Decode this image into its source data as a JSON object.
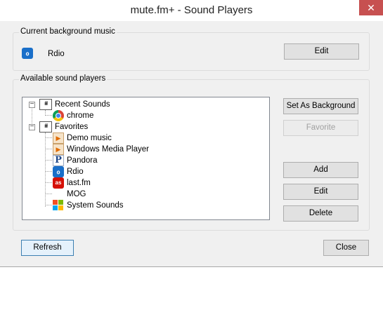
{
  "window": {
    "title": "mute.fm+ - Sound Players",
    "close_glyph": "✕"
  },
  "current_group": {
    "legend": "Current background music",
    "player_name": "Rdio",
    "player_icon": "rdio-icon",
    "edit_label": "Edit"
  },
  "available_group": {
    "legend": "Available sound players",
    "tree": {
      "recent": {
        "label": "Recent Sounds",
        "icon": "equalizer-icon",
        "expanded": true,
        "children": [
          {
            "label": "chrome",
            "icon": "chrome-icon"
          }
        ]
      },
      "favorites": {
        "label": "Favorites",
        "icon": "equalizer-icon",
        "expanded": true,
        "children": [
          {
            "label": "Demo music",
            "icon": "media-icon"
          },
          {
            "label": "Windows Media Player",
            "icon": "media-icon"
          },
          {
            "label": "Pandora",
            "icon": "pandora-icon"
          },
          {
            "label": "Rdio",
            "icon": "rdio-icon"
          },
          {
            "label": "last.fm",
            "icon": "lastfm-icon"
          },
          {
            "label": "MOG",
            "icon": "blank-icon"
          },
          {
            "label": "System Sounds",
            "icon": "windows-icon"
          }
        ]
      }
    },
    "buttons": {
      "set_background": "Set As Background",
      "favorite": "Favorite",
      "add": "Add",
      "edit": "Edit",
      "delete": "Delete"
    }
  },
  "footer": {
    "refresh": "Refresh",
    "close": "Close"
  },
  "glyphs": {
    "rdio": "ℴ",
    "pandora": "P",
    "lastfm": "as",
    "media": "▶",
    "eq": "ıłıł",
    "collapse": "−"
  },
  "colors": {
    "rdio": "#1a6fc9",
    "lastfm": "#d51007",
    "close_button": "#c75050"
  }
}
